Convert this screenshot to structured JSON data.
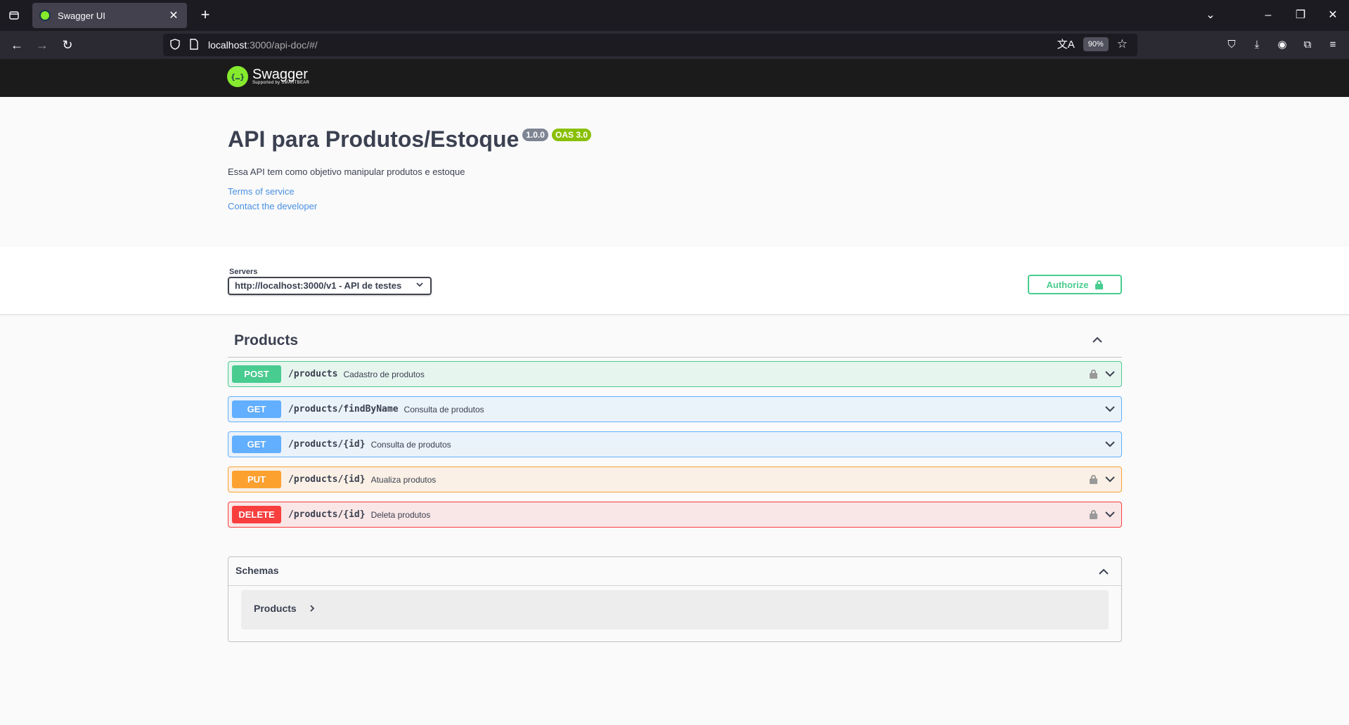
{
  "browser": {
    "tab_title": "Swagger UI",
    "url_host": "localhost",
    "url_path": ":3000/api-doc/#/",
    "zoom": "90%"
  },
  "swagger": {
    "logo_text": "Swagger",
    "logo_sub": "Supported by SMARTBEAR"
  },
  "info": {
    "title": "API para Produtos/Estoque",
    "version": "1.0.0",
    "oas": "OAS 3.0",
    "description": "Essa API tem como objetivo manipular produtos e estoque",
    "terms": "Terms of service",
    "contact": "Contact the developer"
  },
  "servers": {
    "label": "Servers",
    "selected": "http://localhost:3000/v1 - API de testes",
    "authorize": "Authorize"
  },
  "products": {
    "title": "Products",
    "operations": [
      {
        "method": "POST",
        "path": "/products",
        "summary": "Cadastro de produtos",
        "locked": true
      },
      {
        "method": "GET",
        "path": "/products/findByName",
        "summary": "Consulta de produtos",
        "locked": false
      },
      {
        "method": "GET",
        "path": "/products/{id}",
        "summary": "Consulta de produtos",
        "locked": false
      },
      {
        "method": "PUT",
        "path": "/products/{id}",
        "summary": "Atualiza produtos",
        "locked": true
      },
      {
        "method": "DELETE",
        "path": "/products/{id}",
        "summary": "Deleta produtos",
        "locked": true
      }
    ]
  },
  "schemas": {
    "title": "Schemas",
    "items": [
      {
        "name": "Products"
      }
    ]
  },
  "colors": {
    "post": "#49cc90",
    "get": "#61affe",
    "put": "#fca130",
    "delete": "#f93e3e",
    "link": "#4990e2"
  }
}
